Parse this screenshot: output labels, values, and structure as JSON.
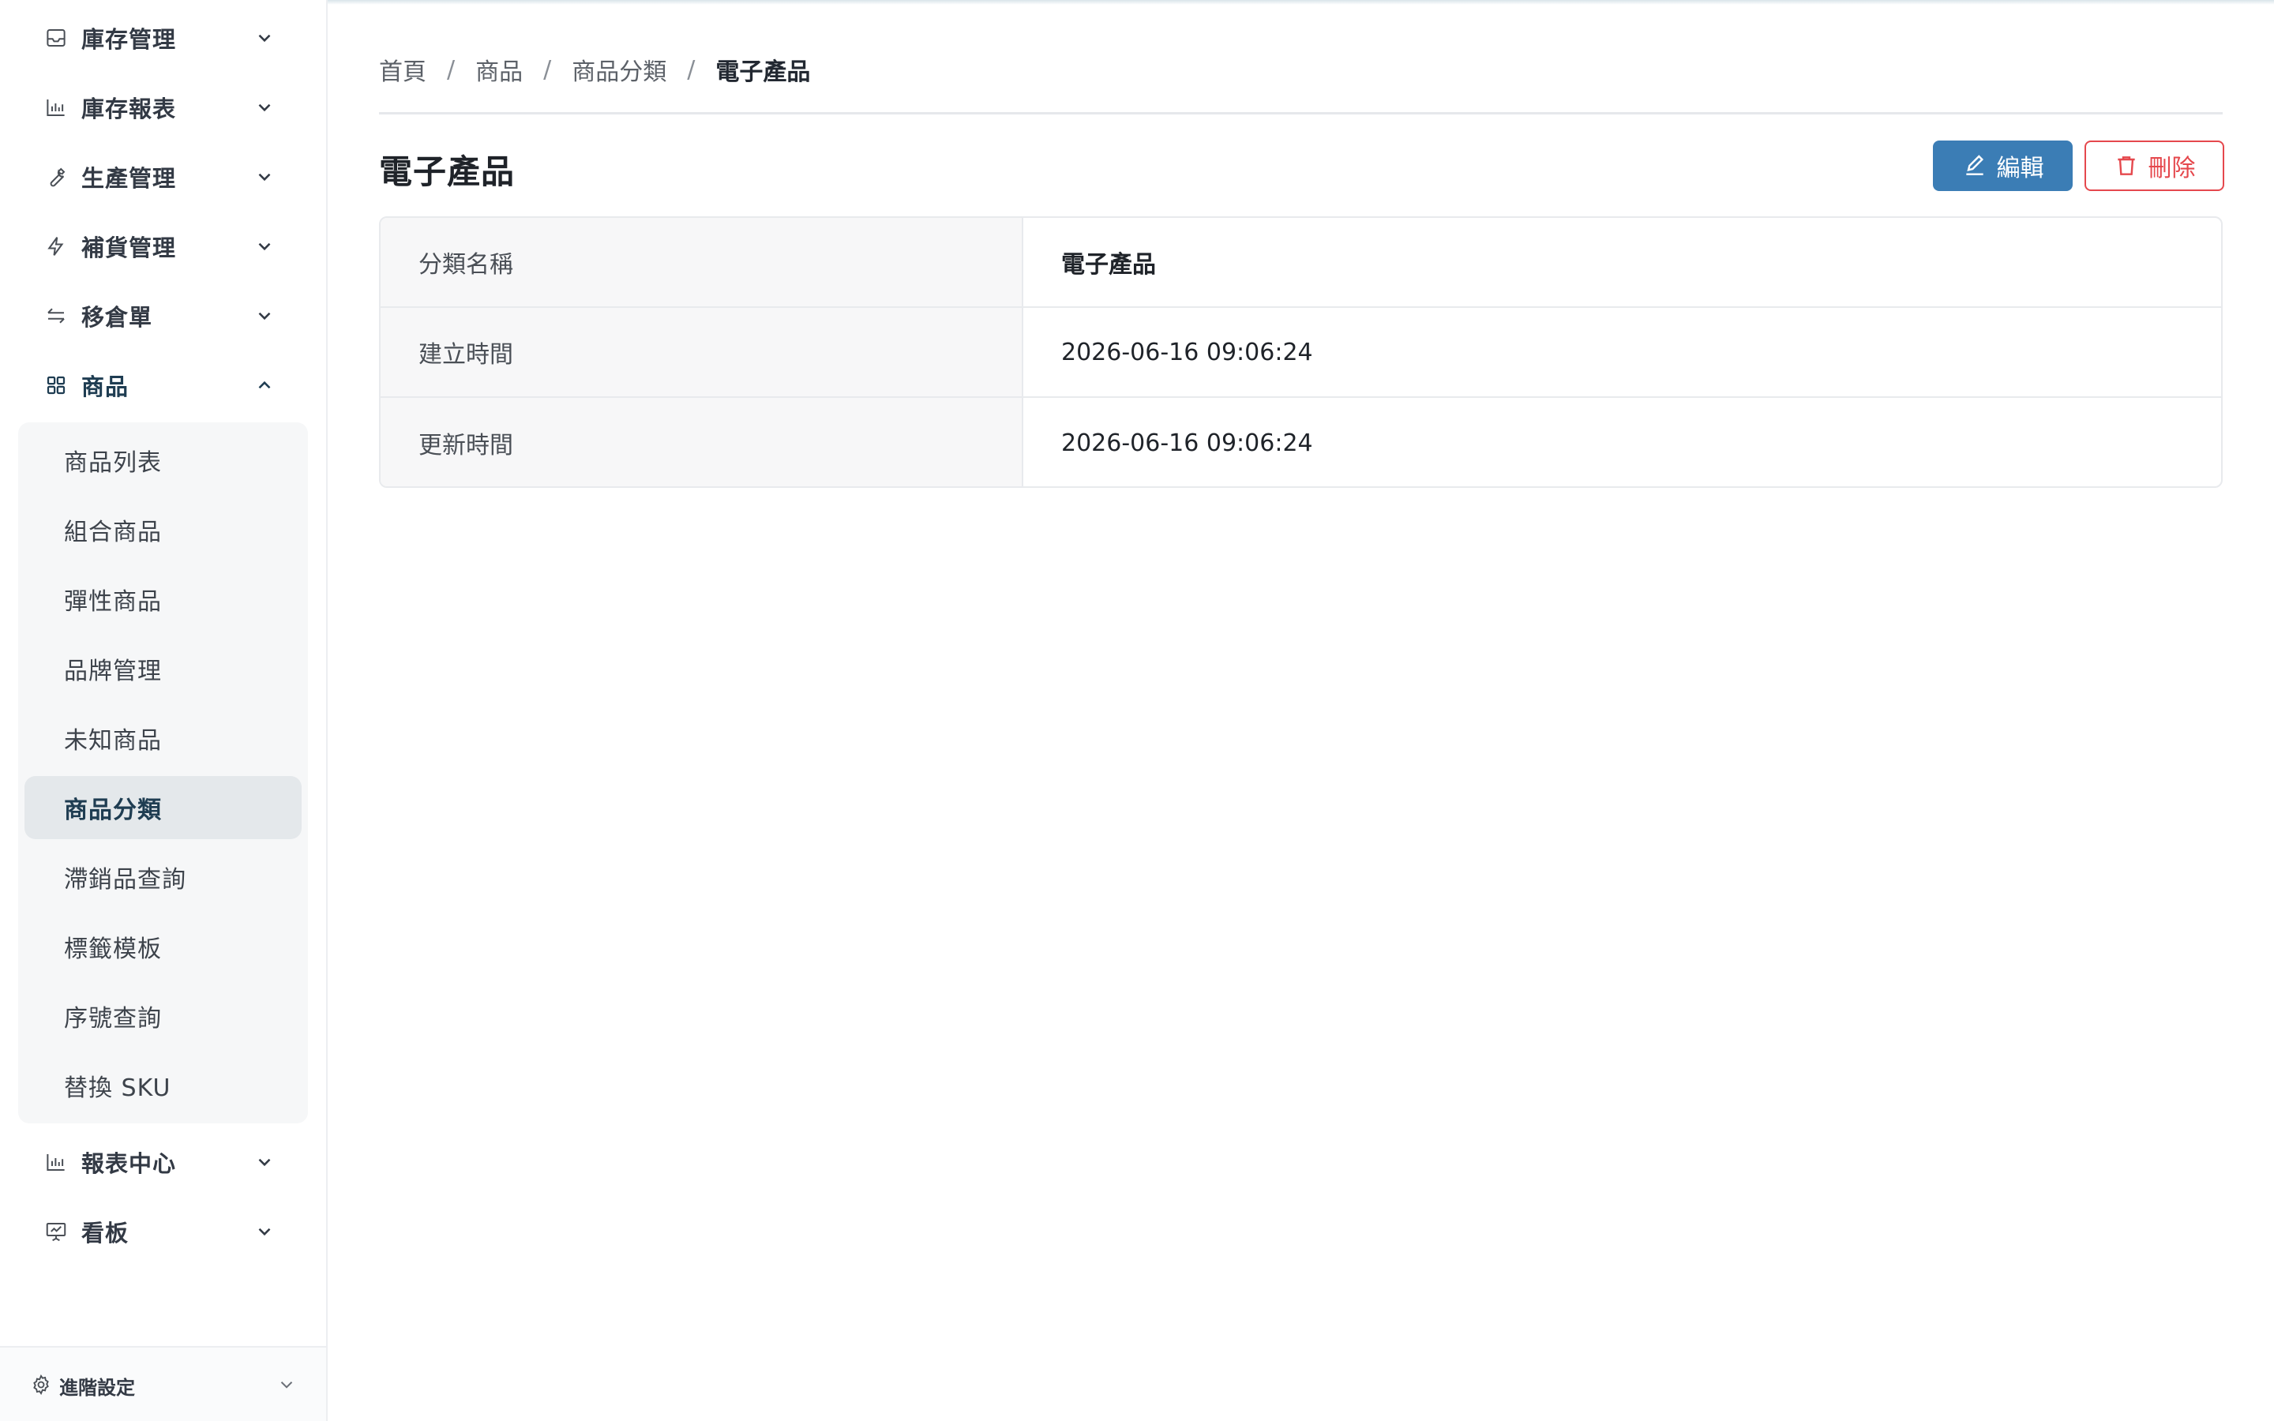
{
  "sidebar": {
    "items": [
      {
        "label": "庫存管理",
        "icon": "inbox-icon"
      },
      {
        "label": "庫存報表",
        "icon": "bar-chart-icon"
      },
      {
        "label": "生產管理",
        "icon": "wrench-icon"
      },
      {
        "label": "補貨管理",
        "icon": "lightning-icon"
      },
      {
        "label": "移倉單",
        "icon": "transfer-icon"
      },
      {
        "label": "商品",
        "icon": "grid-icon"
      },
      {
        "label": "報表中心",
        "icon": "bar-chart-icon"
      },
      {
        "label": "看板",
        "icon": "presentation-chart-icon"
      }
    ],
    "submenu": [
      {
        "label": "商品列表"
      },
      {
        "label": "組合商品"
      },
      {
        "label": "彈性商品"
      },
      {
        "label": "品牌管理"
      },
      {
        "label": "未知商品"
      },
      {
        "label": "商品分類"
      },
      {
        "label": "滯銷品查詢"
      },
      {
        "label": "標籤模板"
      },
      {
        "label": "序號查詢"
      },
      {
        "label": "替換 SKU"
      }
    ],
    "selected_submenu": "商品分類",
    "footer_label": "進階設定"
  },
  "breadcrumb": {
    "items": [
      "首頁",
      "商品",
      "商品分類"
    ],
    "current": "電子產品",
    "separator": "/"
  },
  "page": {
    "title": "電子產品",
    "edit_label": "編輯",
    "delete_label": "刪除"
  },
  "details": [
    {
      "key": "分類名稱",
      "value": "電子產品"
    },
    {
      "key": "建立時間",
      "value": "2026-06-16 09:06:24"
    },
    {
      "key": "更新時間",
      "value": "2026-06-16 09:06:24"
    }
  ],
  "colors": {
    "accent": "#3b7db5",
    "danger": "#e5484d",
    "active_text": "#1f3d52"
  }
}
